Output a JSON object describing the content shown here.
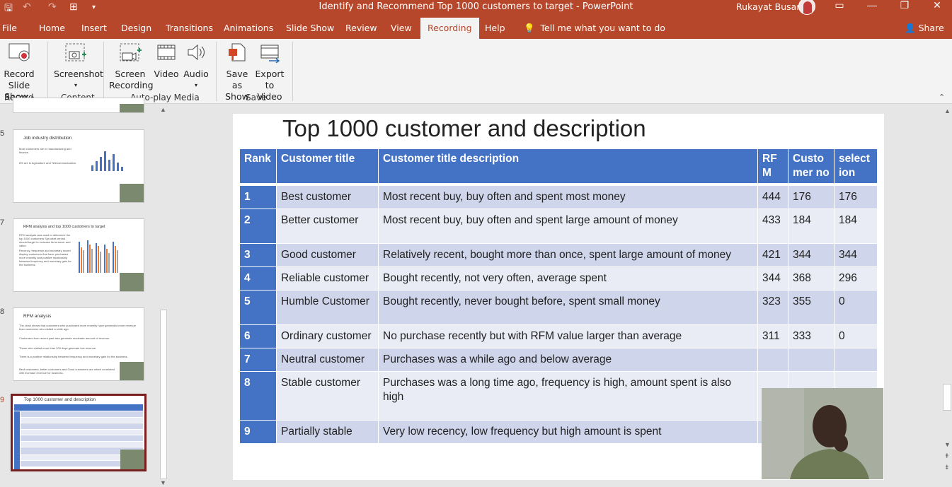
{
  "window": {
    "title": "Identify and Recommend Top 1000 customers to target  -  PowerPoint",
    "user": "Rukayat Busari"
  },
  "tabs": [
    {
      "label": "File"
    },
    {
      "label": "Home"
    },
    {
      "label": "Insert"
    },
    {
      "label": "Design"
    },
    {
      "label": "Transitions"
    },
    {
      "label": "Animations"
    },
    {
      "label": "Slide Show"
    },
    {
      "label": "Review"
    },
    {
      "label": "View"
    },
    {
      "label": "Recording"
    },
    {
      "label": "Help"
    }
  ],
  "active_tab": "Recording",
  "tell_me": "Tell me what you want to do",
  "share": "Share",
  "ribbon": {
    "record_slide_show": {
      "line1": "Record Slide",
      "line2": "Show"
    },
    "screenshot": "Screenshot",
    "screen_recording": {
      "line1": "Screen",
      "line2": "Recording"
    },
    "video": "Video",
    "audio": "Audio",
    "save_as_show": {
      "line1": "Save as",
      "line2": "Show"
    },
    "export_to_video": {
      "line1": "Export",
      "line2": "to Video"
    },
    "groups": {
      "record": "Record",
      "content": "Content",
      "autoplay": "Auto-play Media",
      "save": "Save"
    }
  },
  "thumbnails": [
    {
      "num": "5",
      "title": "Job industry distribution",
      "bullets": [
        "Most customers are in manufacturing and finance.",
        "8% are in Agriculture and Telecommunication."
      ]
    },
    {
      "num": "7",
      "title": "RFM analysis and top 1000 customers to target",
      "bullets": [
        "RFM analysis was used to determine the top 1000 customers Sprocket central should target to increase its turnover and value.",
        "Recency, frequency and monetary model display customers that have purchased more recently and positive relationship between frequency and monetary gain for the business."
      ]
    },
    {
      "num": "8",
      "title": "RFM analysis",
      "bullets": [
        "The chart shows that customers who purchased more recently have generated more revenue than customers who visited a while ago.",
        "Customers from recent past also generate moderate amount of revenue.",
        "Those who visited more than 200 days generate low revenue.",
        "There is a positive relationship between frequency and monetary gain for the business.",
        "Best customers, better customers and Good customers are which correlated with increase revenue for business."
      ]
    },
    {
      "num": "9",
      "title": "Top 1000 customer and description",
      "bullets": []
    }
  ],
  "slide": {
    "title": "Top 1000 customer and description",
    "headers": [
      "Rank",
      "Customer title",
      "Customer title description",
      "RFM",
      "Customer no",
      "selection"
    ],
    "rows": [
      {
        "rank": "1",
        "title": "Best customer",
        "desc": "Most recent buy, buy often and spent most money",
        "rfm": "444",
        "cust": "176",
        "sel": "176"
      },
      {
        "rank": "2",
        "title": "Better customer",
        "desc": "Most recent buy, buy often and spent large amount of money",
        "rfm": "433",
        "cust": "184",
        "sel": "184"
      },
      {
        "rank": "3",
        "title": "Good customer",
        "desc": "Relatively recent, bought more than once, spent large amount of money",
        "rfm": "421",
        "cust": "344",
        "sel": "344"
      },
      {
        "rank": "4",
        "title": "Reliable customer",
        "desc": "Bought recently, not very often, average spent",
        "rfm": "344",
        "cust": "368",
        "sel": "296"
      },
      {
        "rank": "5",
        "title": "Humble Customer",
        "desc": "Bought recently, never bought before, spent small money",
        "rfm": "323",
        "cust": "355",
        "sel": "0"
      },
      {
        "rank": "6",
        "title": "Ordinary customer",
        "desc": "No purchase recently but with RFM value larger than average",
        "rfm": "311",
        "cust": "333",
        "sel": "0"
      },
      {
        "rank": "7",
        "title": "Neutral customer",
        "desc": "Purchases was a while ago and below average",
        "rfm": "",
        "cust": "",
        "sel": ""
      },
      {
        "rank": "8",
        "title": "Stable customer",
        "desc": "Purchases was a long time ago, frequency is high, amount spent is also high",
        "rfm": "",
        "cust": "",
        "sel": ""
      },
      {
        "rank": "9",
        "title": "Partially stable",
        "desc": "Very low recency, low frequency but high amount is spent",
        "rfm": "",
        "cust": "",
        "sel": ""
      }
    ]
  }
}
